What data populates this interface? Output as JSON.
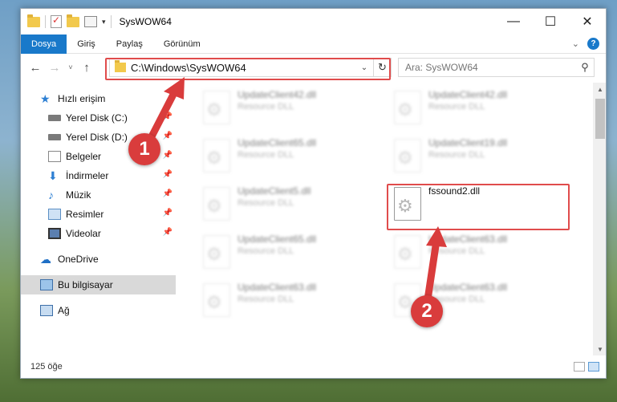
{
  "window": {
    "title": "SysWOW64",
    "controls": {
      "minimize": "—",
      "maximize": "☐",
      "close": "✕"
    }
  },
  "ribbon": {
    "tabs": [
      "Dosya",
      "Giriş",
      "Paylaş",
      "Görünüm"
    ],
    "active_tab": "Dosya",
    "help": "?"
  },
  "nav": {
    "back": "←",
    "forward": "→",
    "recent": "˅",
    "up": "↑",
    "address": "C:\\Windows\\SysWOW64",
    "search_placeholder": "Ara: SysWOW64"
  },
  "sidebar": {
    "items": [
      {
        "label": "Hızlı erişim",
        "icon": "star-icon",
        "pinned": false
      },
      {
        "label": "Yerel Disk (C:)",
        "icon": "drive-icon",
        "pinned": true
      },
      {
        "label": "Yerel Disk (D:)",
        "icon": "drive-icon",
        "pinned": true
      },
      {
        "label": "Belgeler",
        "icon": "documents-icon",
        "pinned": true
      },
      {
        "label": "İndirmeler",
        "icon": "download-icon",
        "pinned": true
      },
      {
        "label": "Müzik",
        "icon": "music-icon",
        "pinned": true
      },
      {
        "label": "Resimler",
        "icon": "pictures-icon",
        "pinned": true
      },
      {
        "label": "Videolar",
        "icon": "video-icon",
        "pinned": true
      },
      {
        "label": "OneDrive",
        "icon": "cloud-icon",
        "pinned": false
      },
      {
        "label": "Bu bilgisayar",
        "icon": "computer-icon",
        "pinned": false
      },
      {
        "label": "Ağ",
        "icon": "network-icon",
        "pinned": false
      }
    ],
    "pin_glyph": "📌"
  },
  "files": [
    {
      "name": "UpdateClient42.dll",
      "type": "Resource DLL",
      "blurred": true
    },
    {
      "name": "UpdateClient42.dll",
      "type": "Resource DLL",
      "blurred": true
    },
    {
      "name": "UpdateClient65.dll",
      "type": "Resource DLL",
      "blurred": true
    },
    {
      "name": "UpdateClient19.dll",
      "type": "Resource DLL",
      "blurred": true
    },
    {
      "name": "UpdateClient5.dll",
      "type": "Resource DLL",
      "blurred": true
    },
    {
      "name": "fssound2.dll",
      "type": "",
      "blurred": false
    },
    {
      "name": "UpdateClient65.dll",
      "type": "Resource DLL",
      "blurred": true
    },
    {
      "name": "UpdateClient63.dll",
      "type": "Resource DLL",
      "blurred": true
    },
    {
      "name": "UpdateClient63.dll",
      "type": "Resource DLL",
      "blurred": true
    },
    {
      "name": "UpdateClient63.dll",
      "type": "Resource DLL",
      "blurred": true
    }
  ],
  "status": {
    "item_count": "125 öğe"
  },
  "annotations": {
    "step1": "1",
    "step2": "2",
    "highlight_color": "#e04c4c"
  }
}
